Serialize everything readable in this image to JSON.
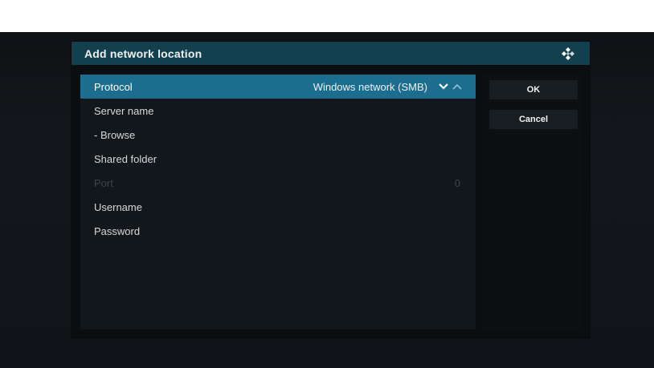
{
  "dialog": {
    "title": "Add network location",
    "icon": "kodi-logo-icon"
  },
  "fields": [
    {
      "label": "Protocol",
      "value": "Windows network (SMB)"
    },
    {
      "label": "Server name",
      "value": ""
    },
    {
      "label": "- Browse",
      "value": ""
    },
    {
      "label": "Shared folder",
      "value": ""
    },
    {
      "label": "Port",
      "value": "0"
    },
    {
      "label": "Username",
      "value": ""
    },
    {
      "label": "Password",
      "value": ""
    }
  ],
  "buttons": {
    "ok": "OK",
    "cancel": "Cancel"
  },
  "colors": {
    "header": "#12404f",
    "selected_row": "#1c6d8e"
  }
}
